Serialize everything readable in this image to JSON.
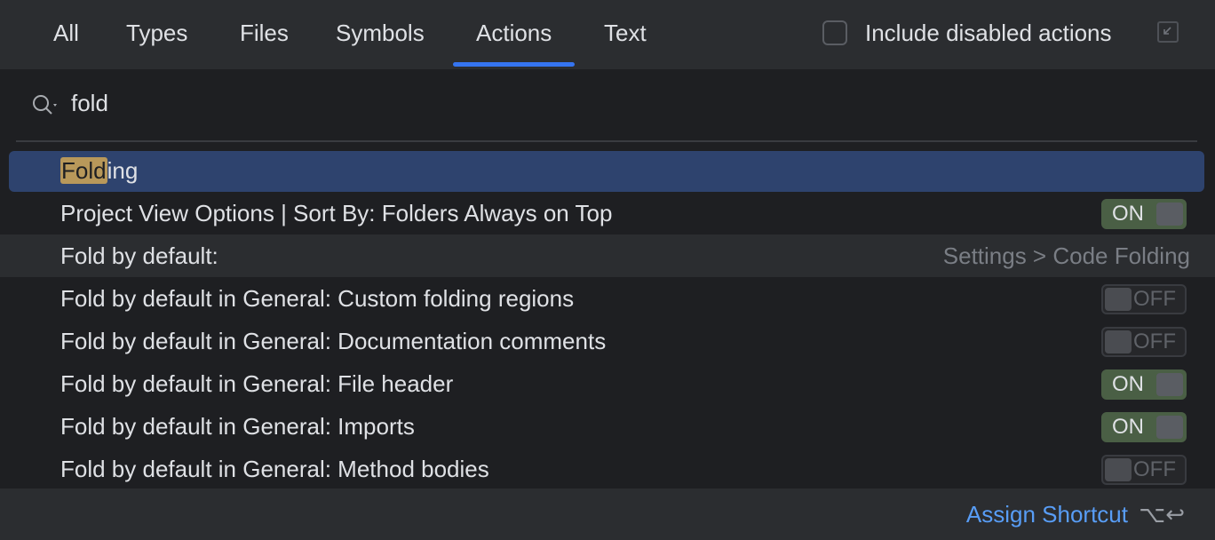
{
  "tabs": [
    {
      "label": "All",
      "active": false
    },
    {
      "label": "Types",
      "active": false
    },
    {
      "label": "Files",
      "active": false
    },
    {
      "label": "Symbols",
      "active": false
    },
    {
      "label": "Actions",
      "active": true
    },
    {
      "label": "Text",
      "active": false
    }
  ],
  "include_disabled": {
    "label": "Include disabled actions",
    "checked": false
  },
  "pin_icon": "expand-window-icon",
  "search": {
    "value": "fold",
    "icon": "search-dropdown-icon"
  },
  "results": [
    {
      "pre": "",
      "match": "Fold",
      "post": "ing",
      "selected": true
    },
    {
      "label": "Project View Options | Sort By: Folders Always on Top",
      "toggle": "ON"
    },
    {
      "label": "Fold by default:",
      "hint": "Settings > Code Folding",
      "group": true
    },
    {
      "label": "Fold by default in General: Custom folding regions",
      "toggle": "OFF"
    },
    {
      "label": "Fold by default in General: Documentation comments",
      "toggle": "OFF"
    },
    {
      "label": "Fold by default in General: File header",
      "toggle": "ON"
    },
    {
      "label": "Fold by default in General: Imports",
      "toggle": "ON"
    },
    {
      "label": "Fold by default in General: Method bodies",
      "toggle": "OFF"
    }
  ],
  "footer": {
    "assign_label": "Assign Shortcut",
    "shortcut": "⌥↩"
  },
  "colors": {
    "accent": "#3574f0",
    "link": "#589df6",
    "selection": "#2e436e",
    "match_highlight": "#b8985a",
    "toggle_on": "#4a5f45"
  }
}
